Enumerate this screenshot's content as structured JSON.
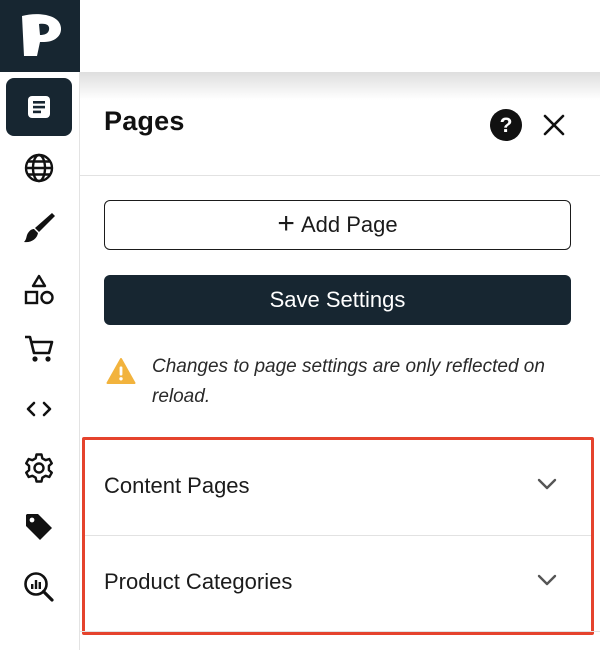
{
  "app": {
    "logo_letter": "P"
  },
  "rail": {
    "items": [
      {
        "id": "pages",
        "icon": "document-icon",
        "active": true
      },
      {
        "id": "globe",
        "icon": "globe-icon",
        "active": false
      },
      {
        "id": "design",
        "icon": "paintbrush-icon",
        "active": false
      },
      {
        "id": "shapes",
        "icon": "shapes-icon",
        "active": false
      },
      {
        "id": "cart",
        "icon": "cart-icon",
        "active": false
      },
      {
        "id": "code",
        "icon": "code-icon",
        "active": false
      },
      {
        "id": "settings",
        "icon": "gear-icon",
        "active": false
      },
      {
        "id": "tags",
        "icon": "tag-icon",
        "active": false
      },
      {
        "id": "analytics",
        "icon": "analytics-search-icon",
        "active": false
      }
    ]
  },
  "panel": {
    "title": "Pages",
    "help_glyph": "?",
    "add_page_label": "Add Page",
    "save_label": "Save Settings",
    "notice": "Changes to page settings are only reflected on reload.",
    "sections": [
      {
        "label": "Content Pages"
      },
      {
        "label": "Product Categories"
      }
    ]
  },
  "colors": {
    "dark_navy": "#172631",
    "highlight_border": "#e5432d",
    "warning": "#f2b33d"
  }
}
